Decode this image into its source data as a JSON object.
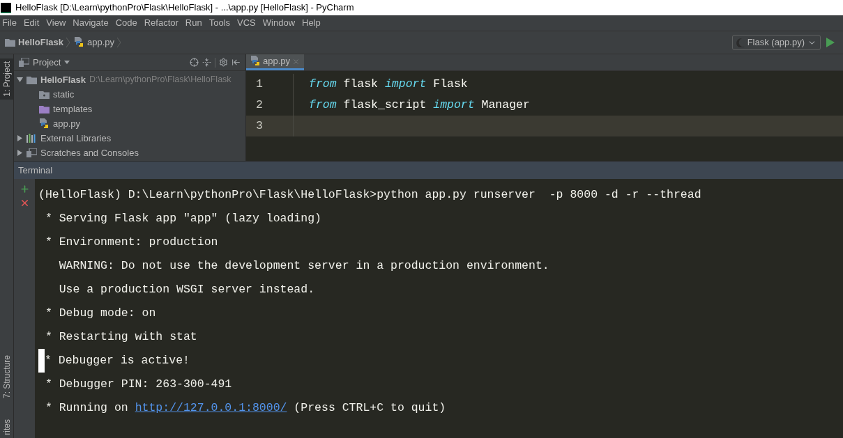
{
  "window": {
    "title": "HelloFlask [D:\\Learn\\pythonPro\\Flask\\HelloFlask] - ...\\app.py [HelloFlask] - PyCharm"
  },
  "menu": [
    {
      "label": "File"
    },
    {
      "label": "Edit"
    },
    {
      "label": "View"
    },
    {
      "label": "Navigate"
    },
    {
      "label": "Code"
    },
    {
      "label": "Refactor"
    },
    {
      "label": "Run"
    },
    {
      "label": "Tools"
    },
    {
      "label": "VCS"
    },
    {
      "label": "Window"
    },
    {
      "label": "Help"
    }
  ],
  "breadcrumb": [
    {
      "label": "HelloFlask",
      "kind": "folder"
    },
    {
      "label": "app.py",
      "kind": "python"
    }
  ],
  "run_config": {
    "label": "Flask (app.py)"
  },
  "left_strip": {
    "top": [
      {
        "label": "1: Project",
        "selected": true
      }
    ],
    "bottom": [
      {
        "label": "7: Structure",
        "selected": false
      },
      {
        "label": "rites",
        "selected": false
      }
    ]
  },
  "project_panel": {
    "title": "Project",
    "tree": [
      {
        "label": "HelloFlask",
        "path": "D:\\Learn\\pythonPro\\Flask\\HelloFlask",
        "kind": "folder",
        "expanded": true,
        "children": [
          {
            "label": "static",
            "kind": "folder"
          },
          {
            "label": "templates",
            "kind": "templates"
          },
          {
            "label": "app.py",
            "kind": "python"
          }
        ]
      },
      {
        "label": "External Libraries",
        "kind": "library",
        "expanded": false
      },
      {
        "label": "Scratches and Consoles",
        "kind": "scratches",
        "expanded": false
      }
    ]
  },
  "editor": {
    "tabs": [
      {
        "label": "app.py",
        "selected": true
      }
    ],
    "lines": [
      {
        "number": "1",
        "current": false,
        "tokens": [
          {
            "text": "from",
            "kind": "keyword"
          },
          {
            "text": " flask ",
            "kind": "plain"
          },
          {
            "text": "import",
            "kind": "keyword"
          },
          {
            "text": " Flask",
            "kind": "plain"
          }
        ]
      },
      {
        "number": "2",
        "current": false,
        "tokens": [
          {
            "text": "from",
            "kind": "keyword"
          },
          {
            "text": " flask_script ",
            "kind": "plain"
          },
          {
            "text": "import",
            "kind": "keyword"
          },
          {
            "text": " Manager",
            "kind": "plain"
          }
        ]
      },
      {
        "number": "3",
        "current": true
      }
    ]
  },
  "terminal": {
    "title": "Terminal",
    "lines": [
      {
        "cursor": false,
        "tokens": [
          {
            "text": "(HelloFlask) D:\\Learn\\pythonPro\\Flask\\HelloFlask>python app.py runserver  -p 8000 -d -r --thread",
            "kind": "text"
          }
        ]
      },
      {
        "cursor": false,
        "tokens": [
          {
            "text": " * Serving Flask app \"app\" (lazy loading)",
            "kind": "text"
          }
        ]
      },
      {
        "cursor": false,
        "tokens": [
          {
            "text": " * Environment: production",
            "kind": "text"
          }
        ]
      },
      {
        "cursor": false,
        "tokens": [
          {
            "text": "   WARNING: Do not use the development server in a production environment.",
            "kind": "text"
          }
        ]
      },
      {
        "cursor": false,
        "tokens": [
          {
            "text": "   Use a production WSGI server instead.",
            "kind": "text"
          }
        ]
      },
      {
        "cursor": false,
        "tokens": [
          {
            "text": " * Debug mode: on",
            "kind": "text"
          }
        ]
      },
      {
        "cursor": false,
        "tokens": [
          {
            "text": " * Restarting with stat",
            "kind": "text"
          }
        ]
      },
      {
        "cursor": true,
        "tokens": [
          {
            "text": "* Debugger is active!",
            "kind": "text"
          }
        ]
      },
      {
        "cursor": false,
        "tokens": [
          {
            "text": " * Debugger PIN: 263-300-491",
            "kind": "text"
          }
        ]
      },
      {
        "cursor": false,
        "tokens": [
          {
            "text": " * Running on ",
            "kind": "text"
          },
          {
            "text": "http://127.0.0.1:8000/",
            "kind": "link"
          },
          {
            "text": " (Press CTRL+C to quit)",
            "kind": "text"
          }
        ]
      }
    ]
  }
}
